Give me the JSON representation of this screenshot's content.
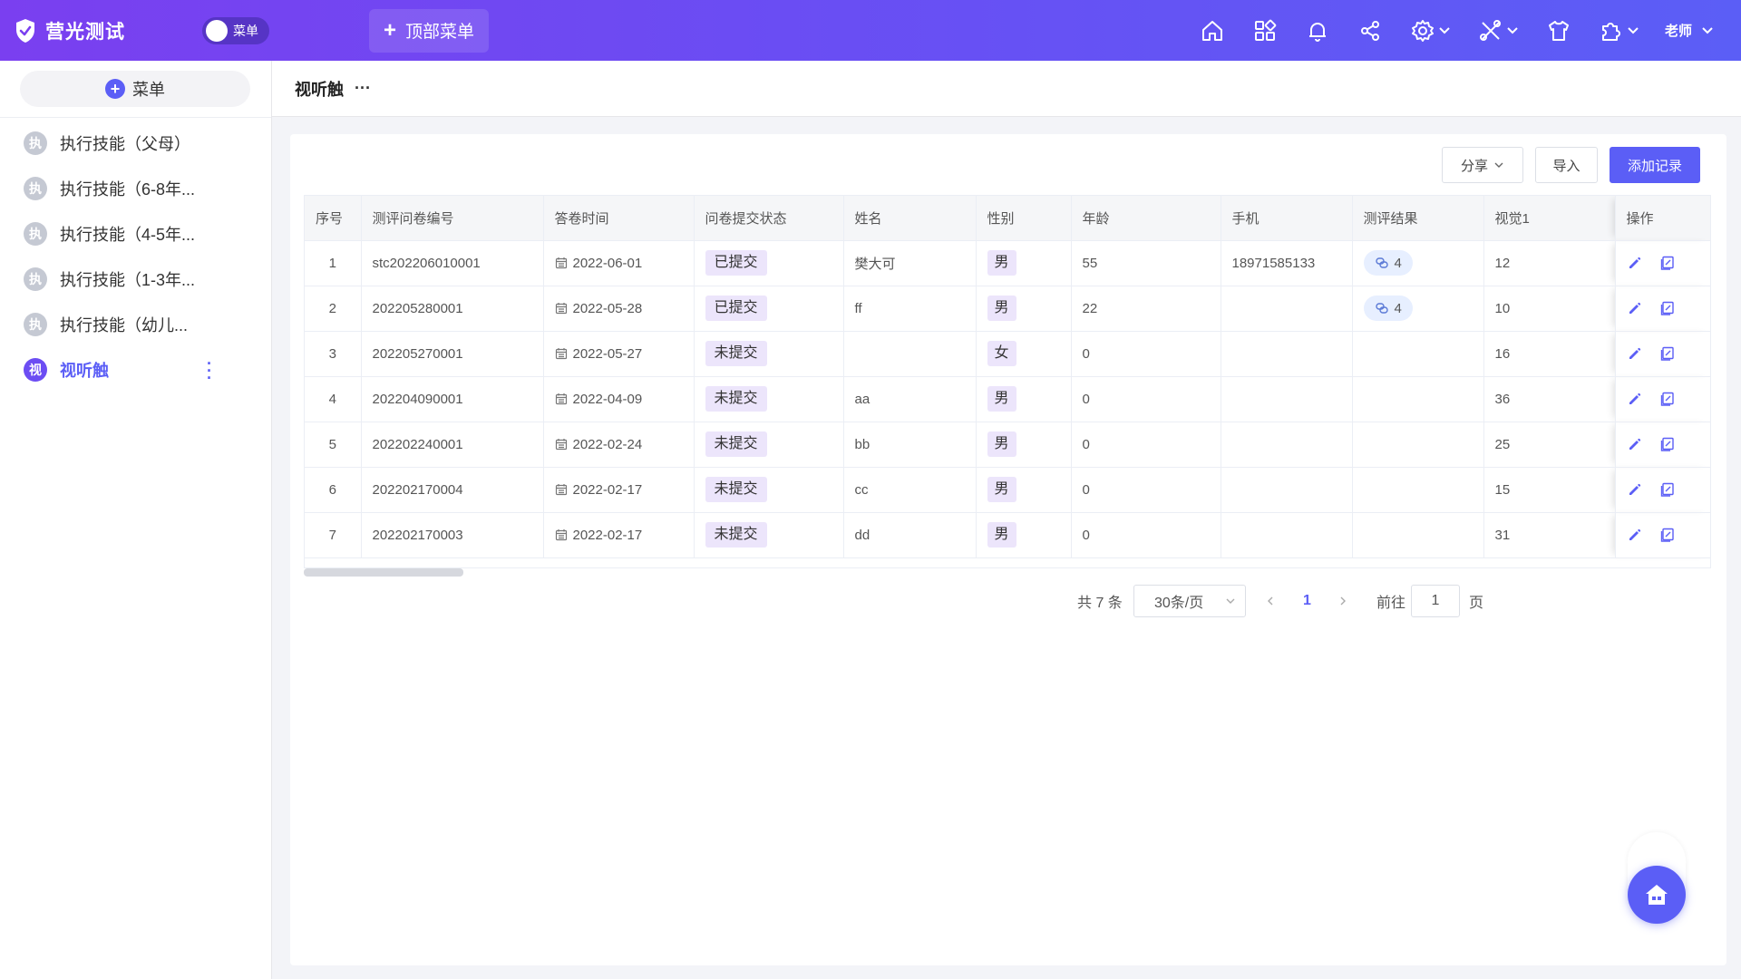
{
  "header": {
    "brand": "营光测试",
    "menu_toggle_label": "菜单",
    "top_menu_label": "顶部菜单",
    "user_label": "老师"
  },
  "sidebar": {
    "add_label": "菜单",
    "items": [
      {
        "icon_char": "执",
        "label": "执行技能（父母）"
      },
      {
        "icon_char": "执",
        "label": "执行技能（6-8年..."
      },
      {
        "icon_char": "执",
        "label": "执行技能（4-5年..."
      },
      {
        "icon_char": "执",
        "label": "执行技能（1-3年..."
      },
      {
        "icon_char": "执",
        "label": "执行技能（幼儿..."
      },
      {
        "icon_char": "视",
        "label": "视听触"
      }
    ]
  },
  "page": {
    "title": "视听触",
    "more": "···"
  },
  "toolbar": {
    "share": "分享",
    "import": "导入",
    "add": "添加记录"
  },
  "table": {
    "headers": [
      "序号",
      "测评问卷编号",
      "答卷时间",
      "问卷提交状态",
      "姓名",
      "性别",
      "年龄",
      "手机",
      "测评结果",
      "视觉1",
      "操作"
    ],
    "rows": [
      {
        "no": "1",
        "code": "stc202206010001",
        "date": "2022-06-01",
        "status": "已提交",
        "name": "樊大可",
        "gender": "男",
        "age": "55",
        "phone": "18971585133",
        "result": "4",
        "v1": "12"
      },
      {
        "no": "2",
        "code": "202205280001",
        "date": "2022-05-28",
        "status": "已提交",
        "name": "ff",
        "gender": "男",
        "age": "22",
        "phone": "",
        "result": "4",
        "v1": "10"
      },
      {
        "no": "3",
        "code": "202205270001",
        "date": "2022-05-27",
        "status": "未提交",
        "name": "",
        "gender": "女",
        "age": "0",
        "phone": "",
        "result": "",
        "v1": "16"
      },
      {
        "no": "4",
        "code": "202204090001",
        "date": "2022-04-09",
        "status": "未提交",
        "name": "aa",
        "gender": "男",
        "age": "0",
        "phone": "",
        "result": "",
        "v1": "36"
      },
      {
        "no": "5",
        "code": "202202240001",
        "date": "2022-02-24",
        "status": "未提交",
        "name": "bb",
        "gender": "男",
        "age": "0",
        "phone": "",
        "result": "",
        "v1": "25"
      },
      {
        "no": "6",
        "code": "202202170004",
        "date": "2022-02-17",
        "status": "未提交",
        "name": "cc",
        "gender": "男",
        "age": "0",
        "phone": "",
        "result": "",
        "v1": "15"
      },
      {
        "no": "7",
        "code": "202202170003",
        "date": "2022-02-17",
        "status": "未提交",
        "name": "dd",
        "gender": "男",
        "age": "0",
        "phone": "",
        "result": "",
        "v1": "31"
      }
    ]
  },
  "pagination": {
    "total": "共 7 条",
    "page_size": "30条/页",
    "current": "1",
    "goto_prefix": "前往",
    "goto_value": "1",
    "goto_suffix": "页"
  },
  "colors": {
    "primary": "#5b5ef6",
    "header_start": "#7a3ff0",
    "tag_bg": "#ece5fb"
  }
}
